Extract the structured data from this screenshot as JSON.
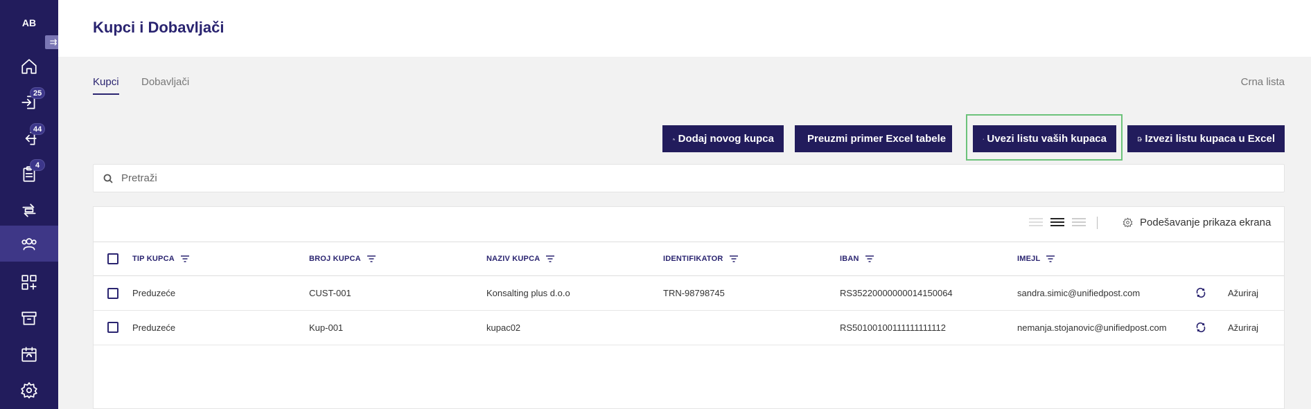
{
  "sidebar": {
    "avatar_initials": "AB",
    "collapse_icon": "⇉",
    "items": [
      {
        "name": "home",
        "badge": null
      },
      {
        "name": "incoming",
        "badge": "25"
      },
      {
        "name": "outgoing",
        "badge": "44"
      },
      {
        "name": "tasks",
        "badge": "4"
      },
      {
        "name": "exchange",
        "badge": null
      },
      {
        "name": "partners",
        "badge": null,
        "active": true
      },
      {
        "name": "apps",
        "badge": null
      },
      {
        "name": "archive",
        "badge": null
      },
      {
        "name": "calendar",
        "badge": null
      },
      {
        "name": "settings",
        "badge": null
      }
    ]
  },
  "header": {
    "title": "Kupci i Dobavljači"
  },
  "tabs": [
    {
      "label": "Kupci",
      "active": true
    },
    {
      "label": "Dobavljači",
      "active": false
    }
  ],
  "blacklist_label": "Crna lista",
  "actions": {
    "add_customer": "Dodaj novog kupca",
    "download_sample": "Preuzmi primer Excel tabele",
    "import_list": "Uvezi listu vaših kupaca",
    "export_list": "Izvezi listu kupaca u Excel"
  },
  "search": {
    "placeholder": "Pretraži",
    "value": ""
  },
  "table": {
    "settings_label": "Podešavanje prikaza ekrana",
    "columns": [
      "TIP KUPCA",
      "BROJ KUPCA",
      "NAZIV KUPCA",
      "IDENTIFIKATOR",
      "IBAN",
      "IMEJL"
    ],
    "rows": [
      {
        "type": "Preduzeće",
        "number": "CUST-001",
        "name": "Konsalting plus d.o.o",
        "identifier": "TRN-98798745",
        "iban": "RS35220000000014150064",
        "email": "sandra.simic@unifiedpost.com",
        "action": "Ažuriraj"
      },
      {
        "type": "Preduzeće",
        "number": "Kup-001",
        "name": "kupac02",
        "identifier": "",
        "iban": "RS50100100111111111112",
        "email": "nemanja.stojanovic@unifiedpost.com",
        "action": "Ažuriraj"
      }
    ]
  },
  "colors": {
    "primary": "#221c5c",
    "accent": "#2a2470",
    "highlight": "#6cc27a"
  }
}
